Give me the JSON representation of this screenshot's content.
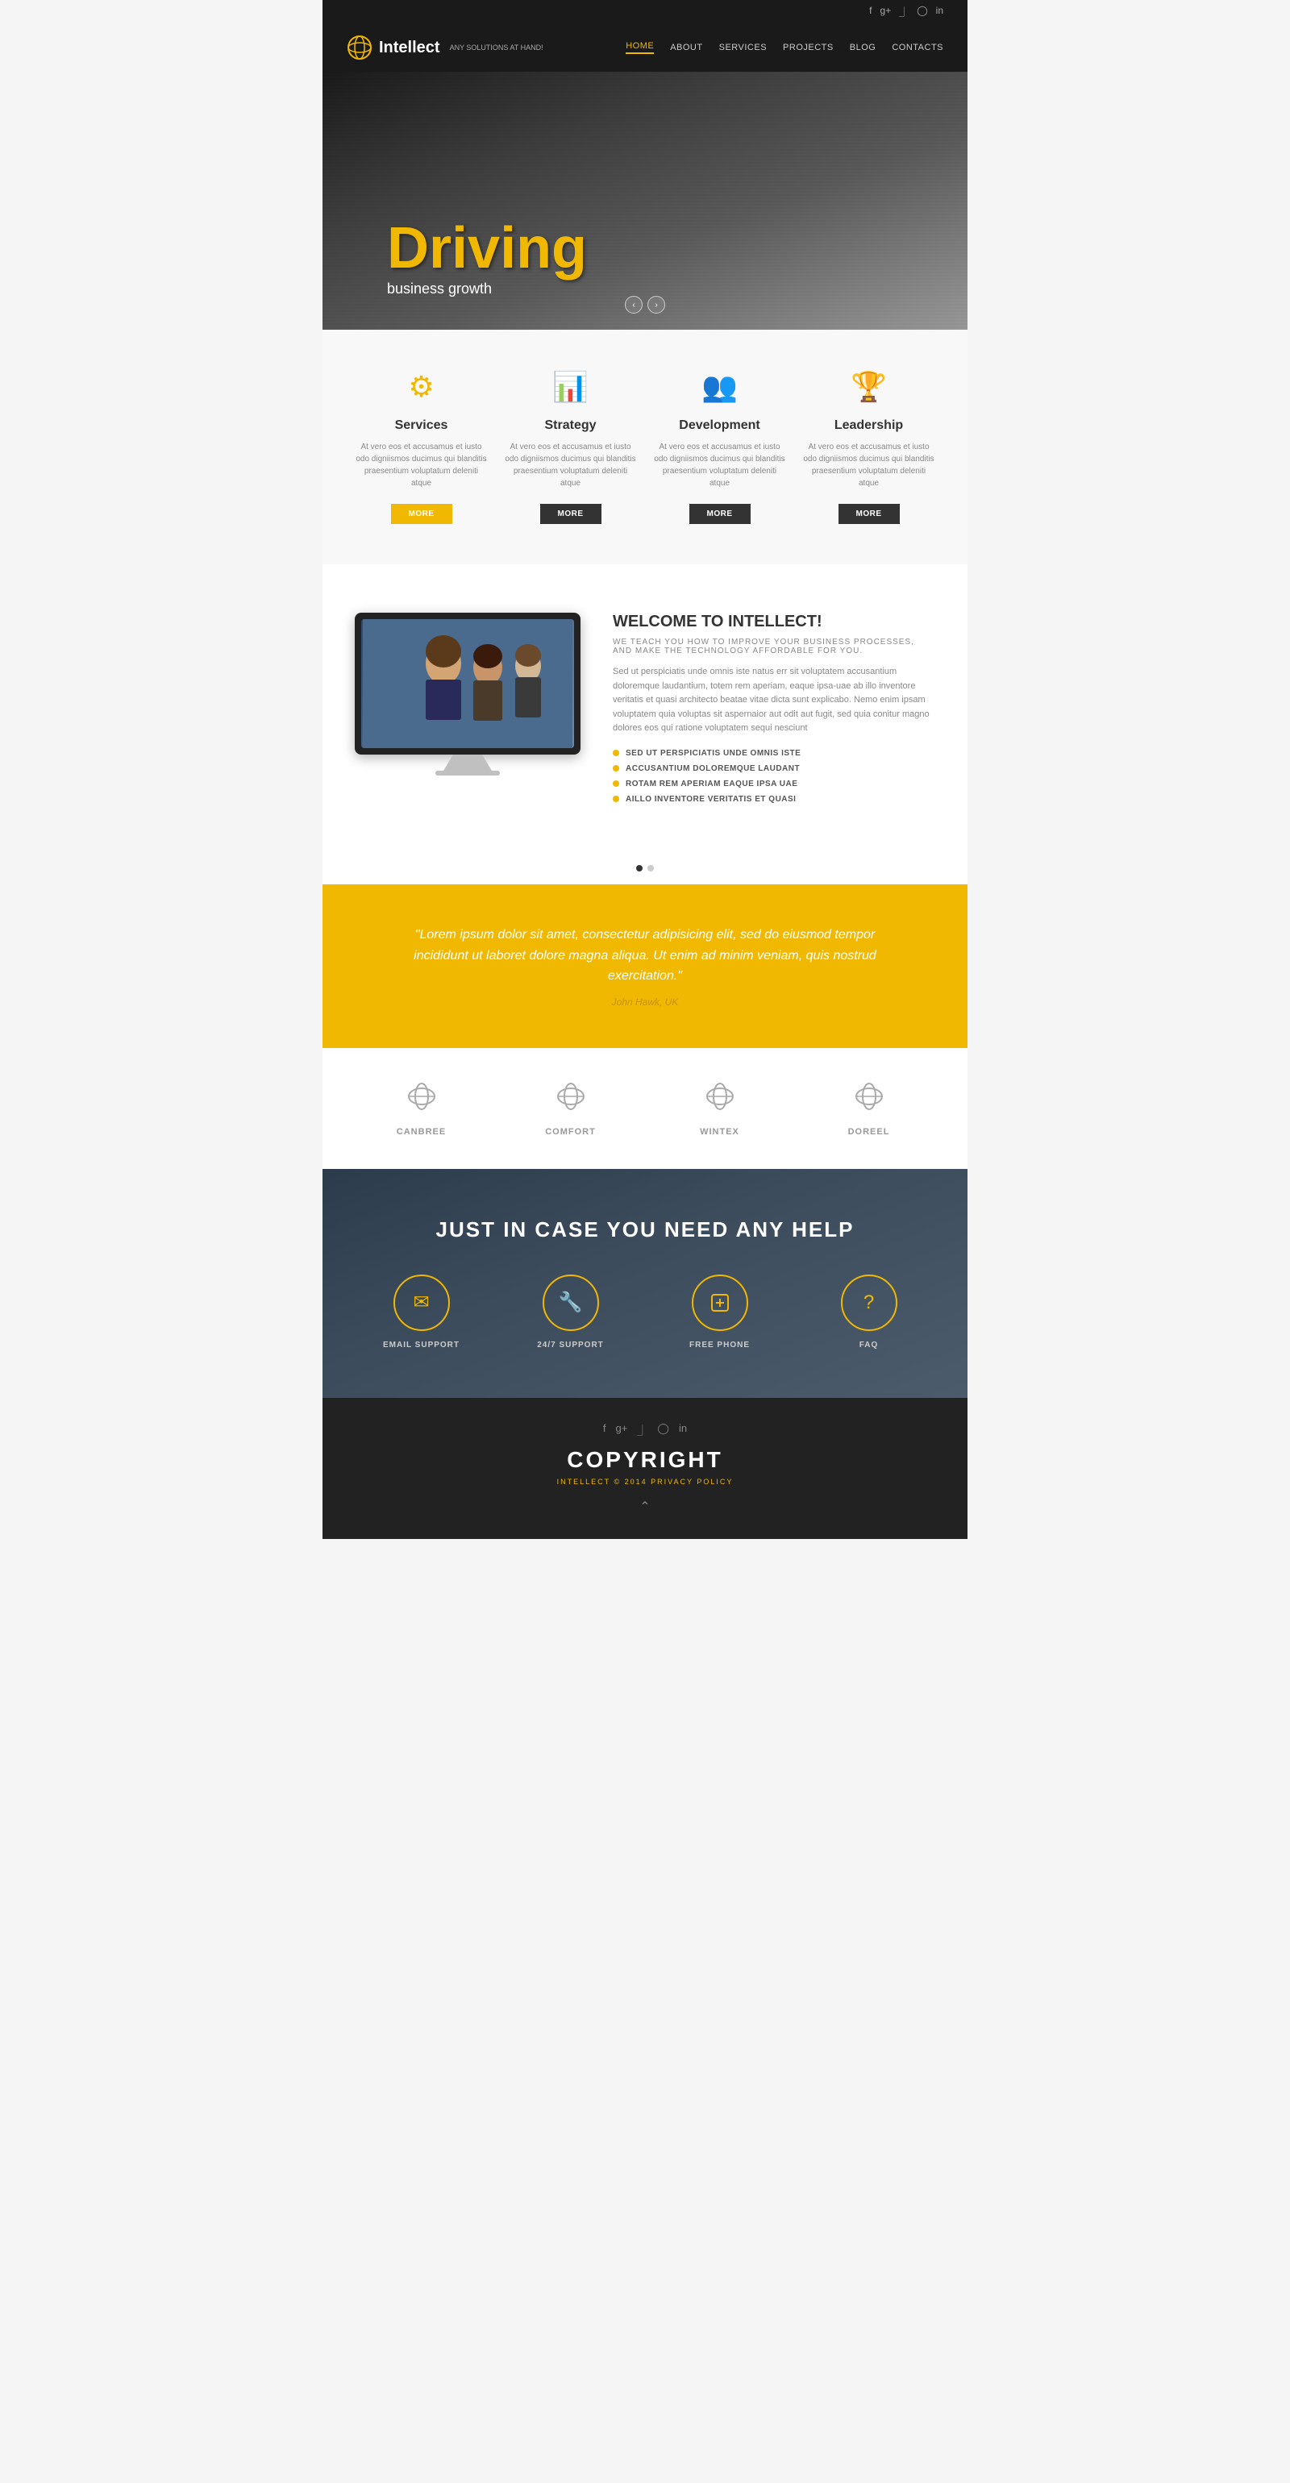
{
  "site": {
    "name": "Intellect",
    "tagline": "ANY SOLUTIONS AT HAND!"
  },
  "header": {
    "social_icons": [
      "f",
      "g+",
      "rss",
      "pin",
      "in"
    ],
    "nav_links": [
      {
        "label": "HOME",
        "active": true
      },
      {
        "label": "ABOUT",
        "active": false
      },
      {
        "label": "SERVICES",
        "active": false
      },
      {
        "label": "PROJECTS",
        "active": false
      },
      {
        "label": "BLOG",
        "active": false
      },
      {
        "label": "CONTACTS",
        "active": false
      }
    ]
  },
  "hero": {
    "title": "Driving",
    "subtitle": "business growth"
  },
  "features": [
    {
      "icon": "⚙",
      "title": "Services",
      "desc": "At vero eos et accusamus et iusto odo digniismos ducimus qui blanditis praesentium voluptatum deleniti atque",
      "btn": "MORE",
      "btn_style": "yellow"
    },
    {
      "icon": "📊",
      "title": "Strategy",
      "desc": "At vero eos et accusamus et iusto odo digniismos ducimus qui blanditis praesentium voluptatum deleniti atque",
      "btn": "MORE",
      "btn_style": "dark"
    },
    {
      "icon": "👥",
      "title": "Development",
      "desc": "At vero eos et accusamus et iusto odo digniismos ducimus qui blanditis praesentium voluptatum deleniti atque",
      "btn": "MORE",
      "btn_style": "dark"
    },
    {
      "icon": "🏆",
      "title": "Leadership",
      "desc": "At vero eos et accusamus et iusto odo digniismos ducimus qui blanditis praesentium voluptatum deleniti atque",
      "btn": "MORE",
      "btn_style": "dark"
    }
  ],
  "welcome": {
    "title": "WELCOME TO INTELLECT!",
    "subtitle": "WE TEACH YOU HOW TO IMPROVE YOUR BUSINESS PROCESSES, AND MAKE THE TECHNOLOGY AFFORDABLE FOR YOU.",
    "text": "Sed ut perspiciatis unde omnis iste natus err sit voluptatem accusantium doloremque laudantium, totem rem aperiam, eaque ipsa-uae ab illo inventore veritatis et quasi architecto beatae vitae dicta sunt explicabo. Nemo enim ipsam voluptatem quia voluptas sit aspernaior aut odit aut fugit, sed quia conitur magno dolores eos qui ratione voluptatem sequi nesciunt",
    "bullets": [
      "SED UT PERSPICIATIS UNDE OMNIS ISTE",
      "ACCUSANTIUM DOLOREMQUE LAUDANT",
      "ROTAM REM APERIAM EAQUE IPSA UAE",
      "AILLO INVENTORE VERITATIS ET QUASI"
    ]
  },
  "testimonial": {
    "text": "\"Lorem ipsum dolor sit amet, consectetur adipisicing elit, sed do eiusmod tempor incididunt ut laboret dolore magna aliqua. Ut enim ad minim veniam, quis nostrud exercitation.\"",
    "author": "John Hawk, UK"
  },
  "partners": [
    {
      "name": "CANBREE",
      "icon": "🍃"
    },
    {
      "name": "COMFORT",
      "icon": "🍃"
    },
    {
      "name": "WINTEX",
      "icon": "🍃"
    },
    {
      "name": "DOREEL",
      "icon": "🍃"
    }
  ],
  "help": {
    "title": "JUST IN CASE YOU NEED ANY HELP",
    "items": [
      {
        "label": "EMAIL SUPPORT",
        "icon": "✉"
      },
      {
        "label": "24/7 SUPPORT",
        "icon": "🔧"
      },
      {
        "label": "FREE PHONE",
        "icon": "◇"
      },
      {
        "label": "FAQ",
        "icon": "?"
      }
    ]
  },
  "footer": {
    "copyright": "COPYRIGHT",
    "brand": "INTELLECT",
    "year": "© 2014",
    "privacy": "PRIVACY POLICY",
    "social_icons": [
      "f",
      "g+",
      "rss",
      "pin",
      "in"
    ]
  }
}
